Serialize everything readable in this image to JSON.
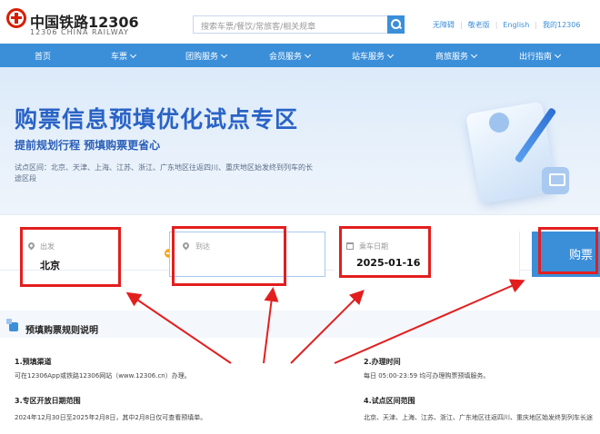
{
  "header": {
    "brand_cn": "中国铁路12306",
    "brand_en": "12306 CHINA RAILWAY",
    "search_placeholder": "搜索车票/餐饮/常旅客/相关规章",
    "links": [
      "无障碍",
      "敬老版",
      "English",
      "我的12306"
    ]
  },
  "nav": {
    "items": [
      {
        "label": "首页",
        "dropdown": false
      },
      {
        "label": "车票",
        "dropdown": true
      },
      {
        "label": "团购服务",
        "dropdown": true
      },
      {
        "label": "会员服务",
        "dropdown": true
      },
      {
        "label": "站车服务",
        "dropdown": true
      },
      {
        "label": "商旅服务",
        "dropdown": true
      },
      {
        "label": "出行指南",
        "dropdown": true
      }
    ]
  },
  "banner": {
    "title": "购票信息预填优化试点专区",
    "subtitle": "提前规划行程 预填购票更省心",
    "desc": "试点区间：北京、天津、上海、江苏、浙江、广东地区往返四川、重庆地区始发终到列车的长途区段"
  },
  "booking": {
    "from_label": "出发",
    "from_value": "北京",
    "to_label": "到达",
    "to_value": "",
    "date_label": "乘车日期",
    "date_value": "2025-01-16",
    "buy_label": "购票"
  },
  "rules": {
    "title": "预填购票规则说明",
    "sections": [
      {
        "heading": "1.预填渠道",
        "text": "可在12306App或铁路12306网站（www.12306.cn）办理。"
      },
      {
        "heading": "2.办理时间",
        "text": "每日 05:00-23:59 均可办理购票预填服务。"
      },
      {
        "heading": "3.专区开放日期范围",
        "text": "2024年12月30日至2025年2月8日，其中2月8日仅可查看预填单。"
      },
      {
        "heading": "4.试点区间范围",
        "text": "北京、天津、上海、江苏、浙江、广东地区往返四川、重庆地区始发终到列车长途"
      }
    ]
  },
  "colors": {
    "brand_red": "#d81e06",
    "accent_blue": "#3b8fd9",
    "annotation_red": "#e31e1e"
  }
}
